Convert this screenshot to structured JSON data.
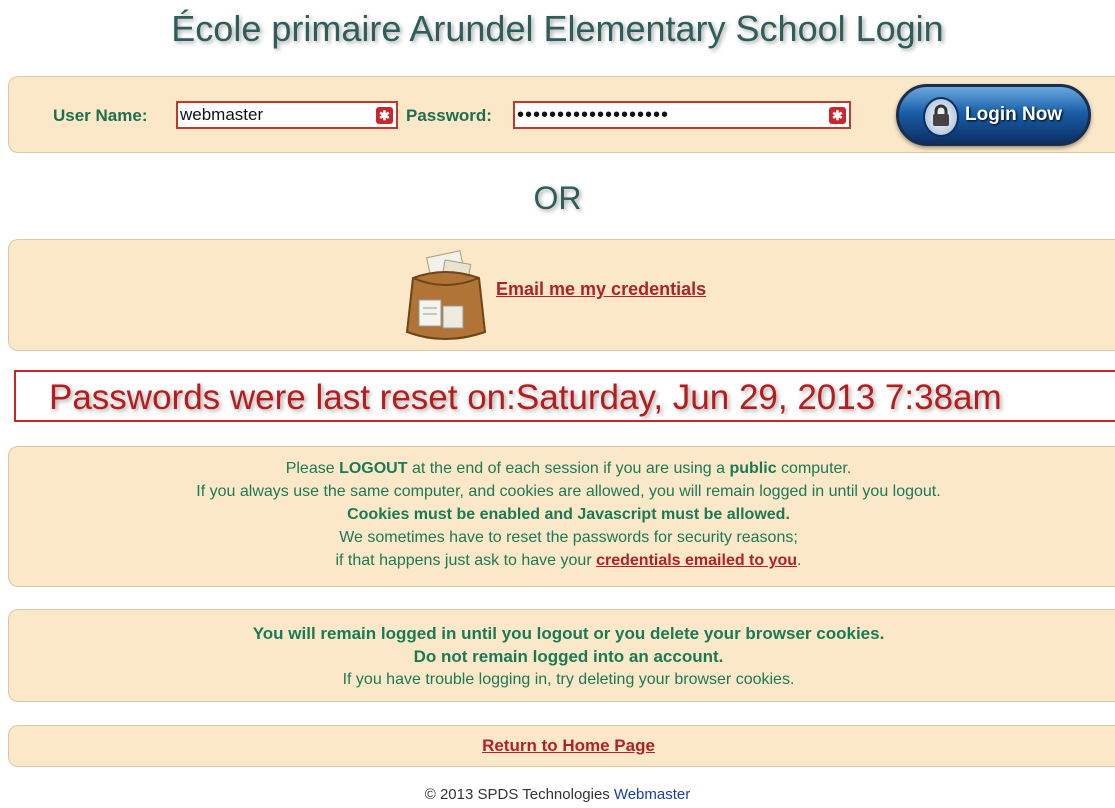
{
  "page": {
    "title": "École primaire Arundel Elementary School Login"
  },
  "login": {
    "username_label": "User Name:",
    "username_value": "webmaster",
    "password_label": "Password:",
    "password_value": "•••••••••••••••••••",
    "clear_glyph": "✱",
    "button_label": "Login Now",
    "button_icon": "lock-icon"
  },
  "or_text": "OR",
  "email": {
    "icon": "satchel-icon",
    "link_label": "Email me my credentials"
  },
  "reset_notice": "Passwords were last reset on:Saturday, Jun 29, 2013 7:38am",
  "info": {
    "line1_pre": "Please ",
    "line1_bold1": "LOGOUT",
    "line1_mid": " at the end of each session if you are using a ",
    "line1_bold2": "public",
    "line1_post": " computer.",
    "line2": "If you always use the same computer, and cookies are allowed, you will remain logged in until you logout.",
    "line3": "Cookies must be enabled and Javascript must be allowed.",
    "line4": "We sometimes have to reset the passwords for security reasons;",
    "line5_pre": "if that happens just ask to have your ",
    "line5_link": "credentials emailed to you",
    "line5_post": "."
  },
  "note": {
    "line1": "You will remain logged in until you logout or you delete your browser cookies.",
    "line2": "Do not remain logged into an account.",
    "line3": "If you have trouble logging in, try deleting your browser cookies."
  },
  "home_link": "Return to Home Page",
  "footer": {
    "copyright": "© 2013 SPDS Technologies",
    "webmaster": "Webmaster"
  },
  "colors": {
    "panel_bg": "#fbe8c9",
    "label_green": "#1f6e4f",
    "link_red": "#b22222",
    "title_slate": "#2e5d5a",
    "button_blue": "#1a5fa8"
  }
}
